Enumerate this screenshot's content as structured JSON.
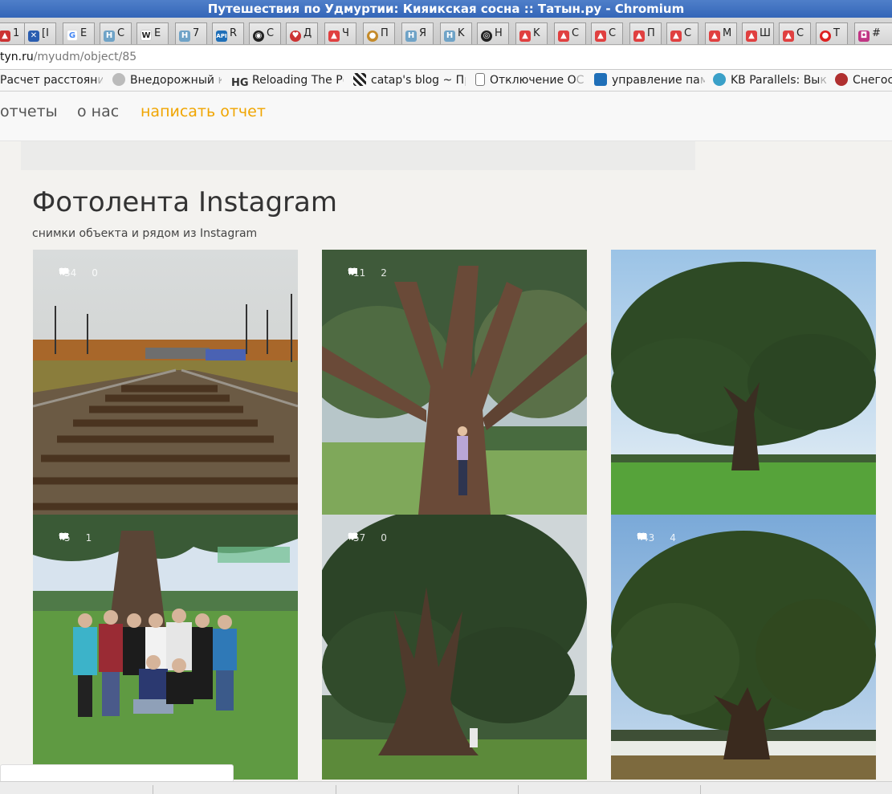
{
  "window": {
    "title": "Путешествия по Удмуртии: Кияикская сосна :: Татын.ру - Chromium"
  },
  "tabs": [
    {
      "label": "1",
      "color": "#c33"
    },
    {
      "label": "[I",
      "color": "#2a5db0"
    },
    {
      "label": "E",
      "color": "#4285f4"
    },
    {
      "label": "C",
      "color": "#6fa3c7"
    },
    {
      "label": "E",
      "color": "#555"
    },
    {
      "label": "7",
      "color": "#6fa3c7"
    },
    {
      "label": "R",
      "color": "#1f6fb8"
    },
    {
      "label": "C",
      "color": "#333"
    },
    {
      "label": "Д",
      "color": "#c33"
    },
    {
      "label": "Ч",
      "color": "#e04040"
    },
    {
      "label": "П",
      "color": "#c48a2a"
    },
    {
      "label": "Я",
      "color": "#6fa3c7"
    },
    {
      "label": "K",
      "color": "#6fa3c7"
    },
    {
      "label": "H",
      "color": "#222"
    },
    {
      "label": "K",
      "color": "#e04040"
    },
    {
      "label": "C",
      "color": "#e04040"
    },
    {
      "label": "C",
      "color": "#e04040"
    },
    {
      "label": "П",
      "color": "#e04040"
    },
    {
      "label": "C",
      "color": "#e04040"
    },
    {
      "label": "M",
      "color": "#e04040"
    },
    {
      "label": "Ш",
      "color": "#e04040"
    },
    {
      "label": "C",
      "color": "#e04040"
    },
    {
      "label": "T",
      "color": "#d22"
    },
    {
      "label": "#",
      "color": "#c13584"
    }
  ],
  "address": {
    "domain": "tyn.ru",
    "path": "/myudm/object/85"
  },
  "bookmarks": [
    {
      "label": "Расчет расстоян",
      "tail": "и",
      "color": "#1a5fb4"
    },
    {
      "label": "Внедорожный",
      "tail": " к",
      "color": "#888"
    },
    {
      "label": "Reloading The P",
      "tail": "c",
      "color": "#333"
    },
    {
      "label": "catap's blog ~ П",
      "tail": "р",
      "color": "#222"
    },
    {
      "label": "Отключение О",
      "tail": "С",
      "color": "#999"
    },
    {
      "label": "управление па",
      "tail": "м",
      "color": "#1f6fb8"
    },
    {
      "label": "KB Parallels: Вы",
      "tail": "к",
      "color": "#3aa0c8"
    },
    {
      "label": "Снегос",
      "tail": "",
      "color": "#b03030"
    }
  ],
  "nav": {
    "reports": "отчеты",
    "about": "о нас",
    "write": "написать отчет"
  },
  "section": {
    "title": "Фотолента Instagram",
    "subtitle": "снимки объекта и рядом из Instagram"
  },
  "photos": [
    {
      "likes": "34",
      "comments": "0",
      "scene": "railway"
    },
    {
      "likes": "11",
      "comments": "2",
      "scene": "trunk-woman"
    },
    {
      "likes": "",
      "comments": "",
      "scene": "tree-sky"
    },
    {
      "likes": "5",
      "comments": "1",
      "scene": "group"
    },
    {
      "likes": "57",
      "comments": "0",
      "scene": "tall-tree"
    },
    {
      "likes": "43",
      "comments": "4",
      "scene": "tree-snow"
    }
  ],
  "colors": {
    "accent": "#f0a500",
    "titlebar": "#3466b8"
  }
}
